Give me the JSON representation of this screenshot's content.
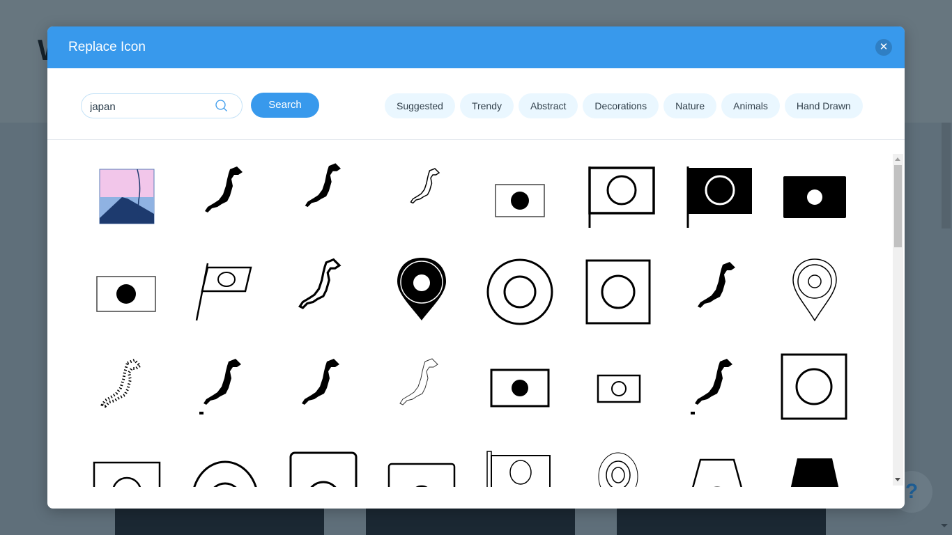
{
  "background": {
    "letter": "W",
    "help_label": "?"
  },
  "modal": {
    "title": "Replace Icon",
    "close_icon": "close-icon"
  },
  "search": {
    "value": "japan",
    "placeholder": "",
    "button_label": "Search"
  },
  "categories": [
    "Suggested",
    "Trendy",
    "Abstract",
    "Decorations",
    "Nature",
    "Animals",
    "Hand Drawn"
  ],
  "icons": [
    {
      "name": "mount-fuji-illustration-icon"
    },
    {
      "name": "japan-map-silhouette-icon"
    },
    {
      "name": "japan-map-detailed-icon"
    },
    {
      "name": "japan-map-outline-small-icon"
    },
    {
      "name": "japan-flag-thin-icon"
    },
    {
      "name": "japan-flag-pole-outline-icon"
    },
    {
      "name": "japan-flag-pole-filled-icon"
    },
    {
      "name": "japan-flag-filled-icon"
    },
    {
      "name": "japan-flag-icon"
    },
    {
      "name": "japan-flag-waving-icon"
    },
    {
      "name": "japan-map-outline-icon"
    },
    {
      "name": "map-pin-filled-icon"
    },
    {
      "name": "double-circle-icon"
    },
    {
      "name": "square-circle-icon"
    },
    {
      "name": "japan-map-filled-icon"
    },
    {
      "name": "map-pin-outline-icon"
    },
    {
      "name": "japan-map-dotted-icon"
    },
    {
      "name": "japan-map-pixel-icon"
    },
    {
      "name": "japan-map-black-icon"
    },
    {
      "name": "japan-map-line-icon"
    },
    {
      "name": "japan-flag-bold-icon"
    },
    {
      "name": "japan-flag-small-icon"
    },
    {
      "name": "japan-map-pixel-2-icon"
    },
    {
      "name": "square-circle-large-icon"
    },
    {
      "name": "flag-partial-icon"
    },
    {
      "name": "arch-icon"
    },
    {
      "name": "rounded-square-circle-icon"
    },
    {
      "name": "rounded-flag-icon"
    },
    {
      "name": "flag-pole-partial-icon"
    },
    {
      "name": "pin-rings-icon"
    },
    {
      "name": "trapezoid-outline-icon"
    },
    {
      "name": "trapezoid-filled-icon"
    }
  ]
}
